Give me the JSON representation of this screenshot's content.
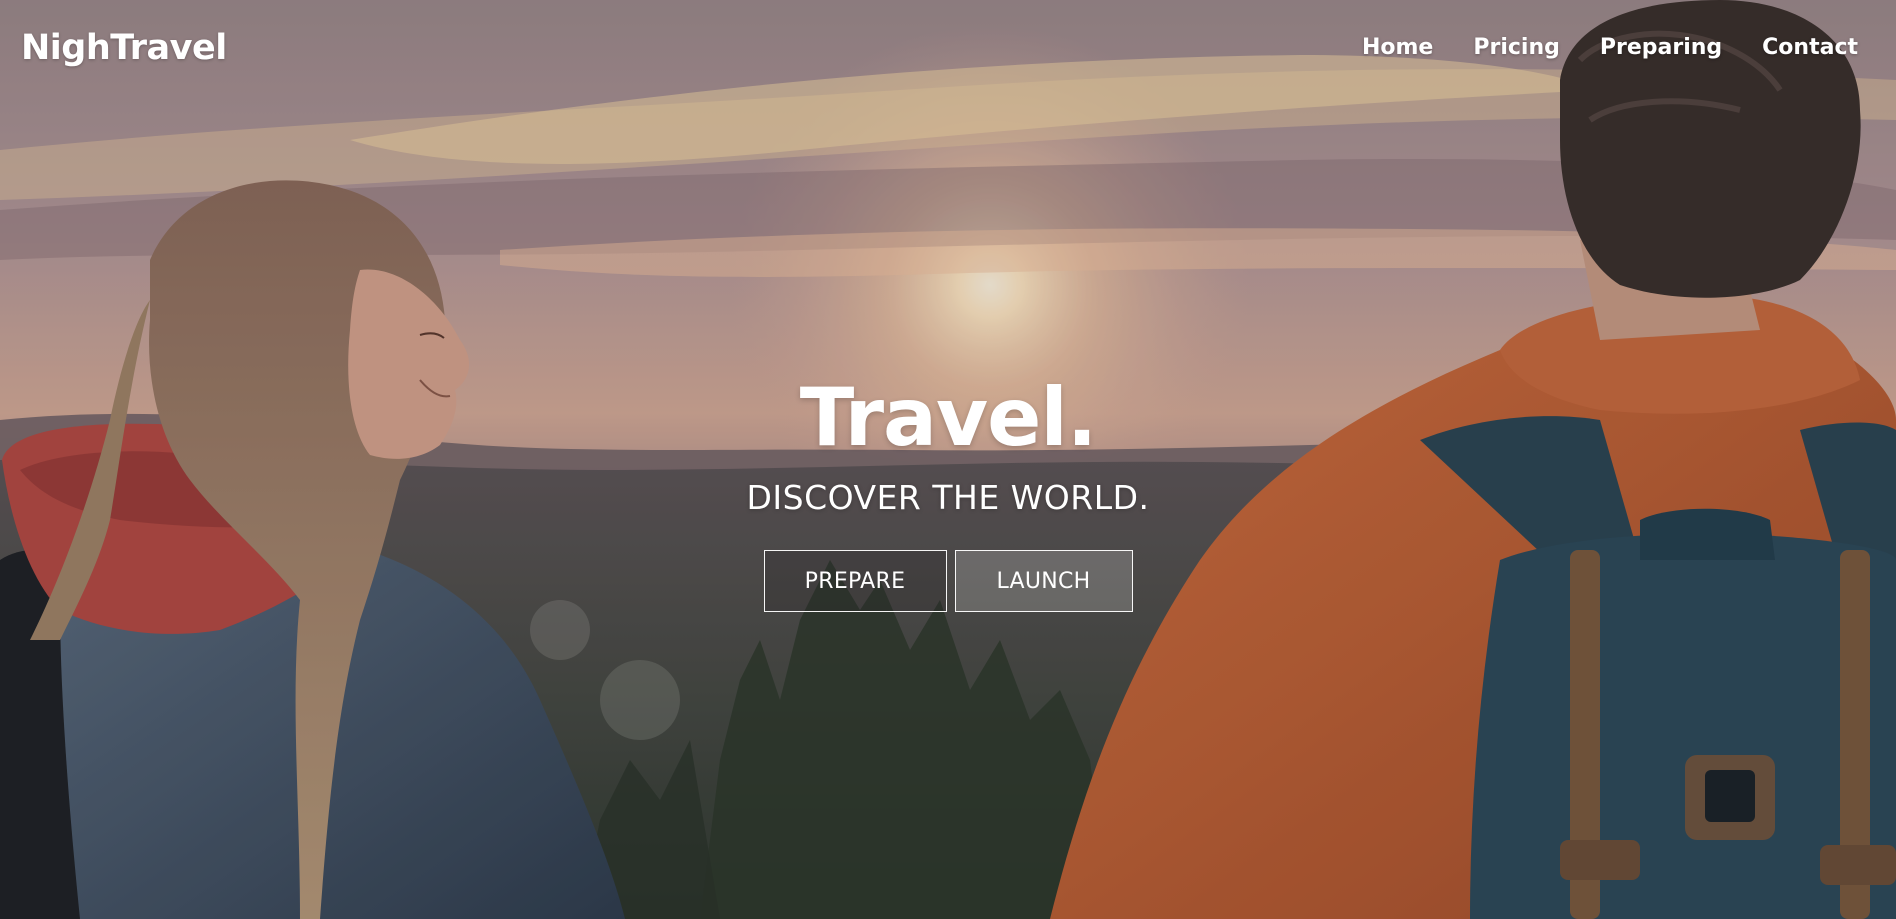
{
  "brand": {
    "logo_text": "NighTravel"
  },
  "nav": {
    "items": [
      {
        "label": "Home"
      },
      {
        "label": "Pricing"
      },
      {
        "label": "Preparing"
      },
      {
        "label": "Contact"
      }
    ]
  },
  "hero": {
    "title": "Travel.",
    "subtitle": "DISCOVER THE WORLD.",
    "background": "sunset-over-forest-with-two-hikers-photo",
    "buttons": {
      "prepare_label": "PREPARE",
      "launch_label": "LAUNCH"
    }
  },
  "colors": {
    "text": "#ffffff",
    "sky": "#b59a94",
    "sun": "#fff1d6",
    "forest": "#3f4a3f",
    "jacket": "#c9673a",
    "backpack": "#2b4a5a",
    "hood": "#b84a42",
    "denim": "#3d5166"
  }
}
